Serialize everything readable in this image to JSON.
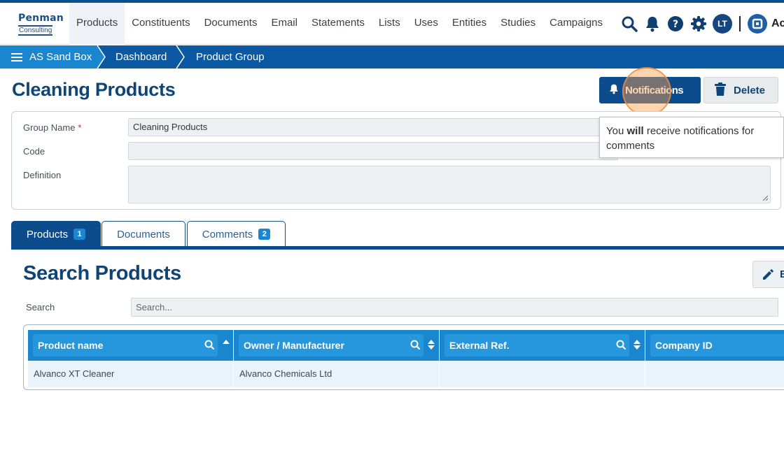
{
  "brand": {
    "line1": "Penman",
    "line2": "Consulting"
  },
  "nav": {
    "items": [
      {
        "label": "Products",
        "active": true
      },
      {
        "label": "Constituents"
      },
      {
        "label": "Documents"
      },
      {
        "label": "Email"
      },
      {
        "label": "Statements"
      },
      {
        "label": "Lists"
      },
      {
        "label": "Uses"
      },
      {
        "label": "Entities"
      },
      {
        "label": "Studies"
      },
      {
        "label": "Campaigns"
      }
    ],
    "icons": [
      "search-icon",
      "bell-icon",
      "help-icon",
      "gear-icon"
    ],
    "avatar_initials": "LT",
    "account_label": "Ac"
  },
  "breadcrumb": {
    "items": [
      "AS Sand Box",
      "Dashboard",
      "Product Group"
    ]
  },
  "page": {
    "title": "Cleaning Products",
    "notifications_label": "Notifications",
    "delete_label": "Delete"
  },
  "form": {
    "group_name_label": "Group Name",
    "required_mark": "*",
    "group_name_value": "Cleaning Products",
    "code_label": "Code",
    "code_value": "",
    "definition_label": "Definition",
    "definition_value": ""
  },
  "tooltip": {
    "pre": "You ",
    "bold": "will",
    "post": " receive notifications for comments"
  },
  "tabs": [
    {
      "label": "Products",
      "badge": "1",
      "active": true
    },
    {
      "label": "Documents"
    },
    {
      "label": "Comments",
      "badge": "2"
    }
  ],
  "search": {
    "title": "Search Products",
    "edit_label": "E",
    "search_label": "Search",
    "search_placeholder": "Search...",
    "search_value": ""
  },
  "table": {
    "columns": [
      "Product name",
      "Owner / Manufacturer",
      "External Ref.",
      "Company ID"
    ],
    "rows": [
      [
        "Alvanco XT Cleaner",
        "Alvanco Chemicals Ltd",
        "",
        ""
      ]
    ]
  },
  "colors": {
    "primary": "#0d4c8c",
    "accent": "#1b86d0",
    "highlight": "#f8a050"
  }
}
